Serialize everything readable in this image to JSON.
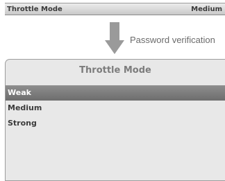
{
  "top_bar": {
    "label": "Throttle Mode",
    "value": "Medium"
  },
  "transition": {
    "caption": "Password verification",
    "icon": "arrow-down-icon"
  },
  "screen": {
    "title": "Throttle Mode",
    "options": [
      {
        "label": "Weak",
        "selected": true
      },
      {
        "label": "Medium",
        "selected": false
      },
      {
        "label": "Strong",
        "selected": false
      }
    ]
  },
  "colors": {
    "selection": "#7a7a7a",
    "screen_bg": "#e8e8e8"
  }
}
